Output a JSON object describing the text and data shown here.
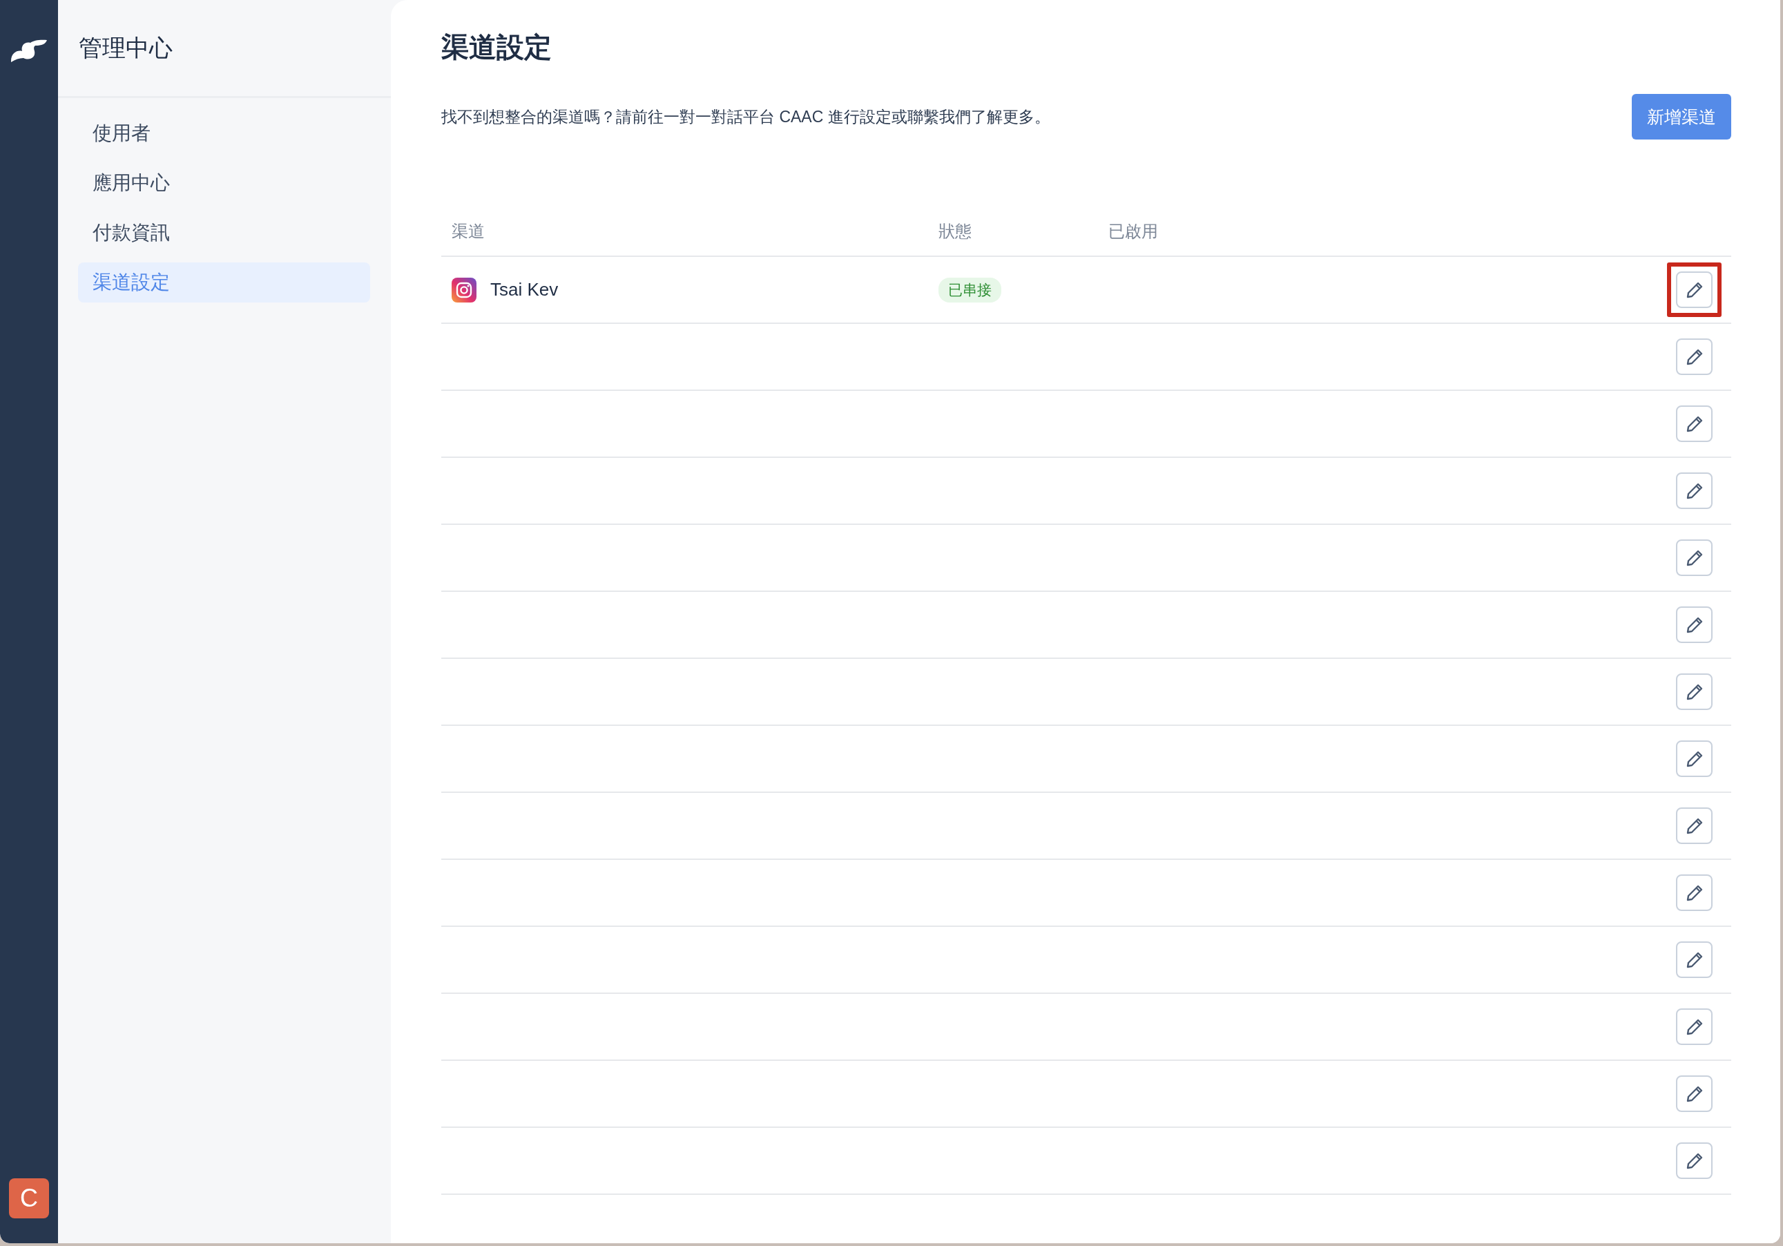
{
  "rail": {
    "avatar": "C"
  },
  "sidebar": {
    "title": "管理中心",
    "items": [
      {
        "label": "使用者",
        "selected": false
      },
      {
        "label": "應用中心",
        "selected": false
      },
      {
        "label": "付款資訊",
        "selected": false
      },
      {
        "label": "渠道設定",
        "selected": true
      }
    ]
  },
  "page": {
    "title": "渠道設定",
    "description": "找不到想整合的渠道嗎？請前往一對一對話平台 CAAC 進行設定或聯繫我們了解更多。",
    "add_button": "新增渠道"
  },
  "table": {
    "columns": [
      "渠道",
      "狀態",
      "已啟用"
    ],
    "rows": [
      {
        "kind": "instagram",
        "channel": "Tsai Kev",
        "status": "已串接",
        "highlighted": true
      },
      {
        "kind": "empty",
        "highlighted": false
      },
      {
        "kind": "empty",
        "highlighted": false
      },
      {
        "kind": "empty",
        "highlighted": false
      },
      {
        "kind": "empty",
        "highlighted": false
      },
      {
        "kind": "empty",
        "highlighted": false
      },
      {
        "kind": "empty",
        "highlighted": false
      },
      {
        "kind": "empty",
        "highlighted": false
      },
      {
        "kind": "empty",
        "highlighted": false
      },
      {
        "kind": "empty",
        "highlighted": false
      },
      {
        "kind": "empty",
        "highlighted": false
      },
      {
        "kind": "empty",
        "highlighted": false
      },
      {
        "kind": "empty",
        "highlighted": false
      },
      {
        "kind": "empty",
        "highlighted": false
      }
    ]
  }
}
